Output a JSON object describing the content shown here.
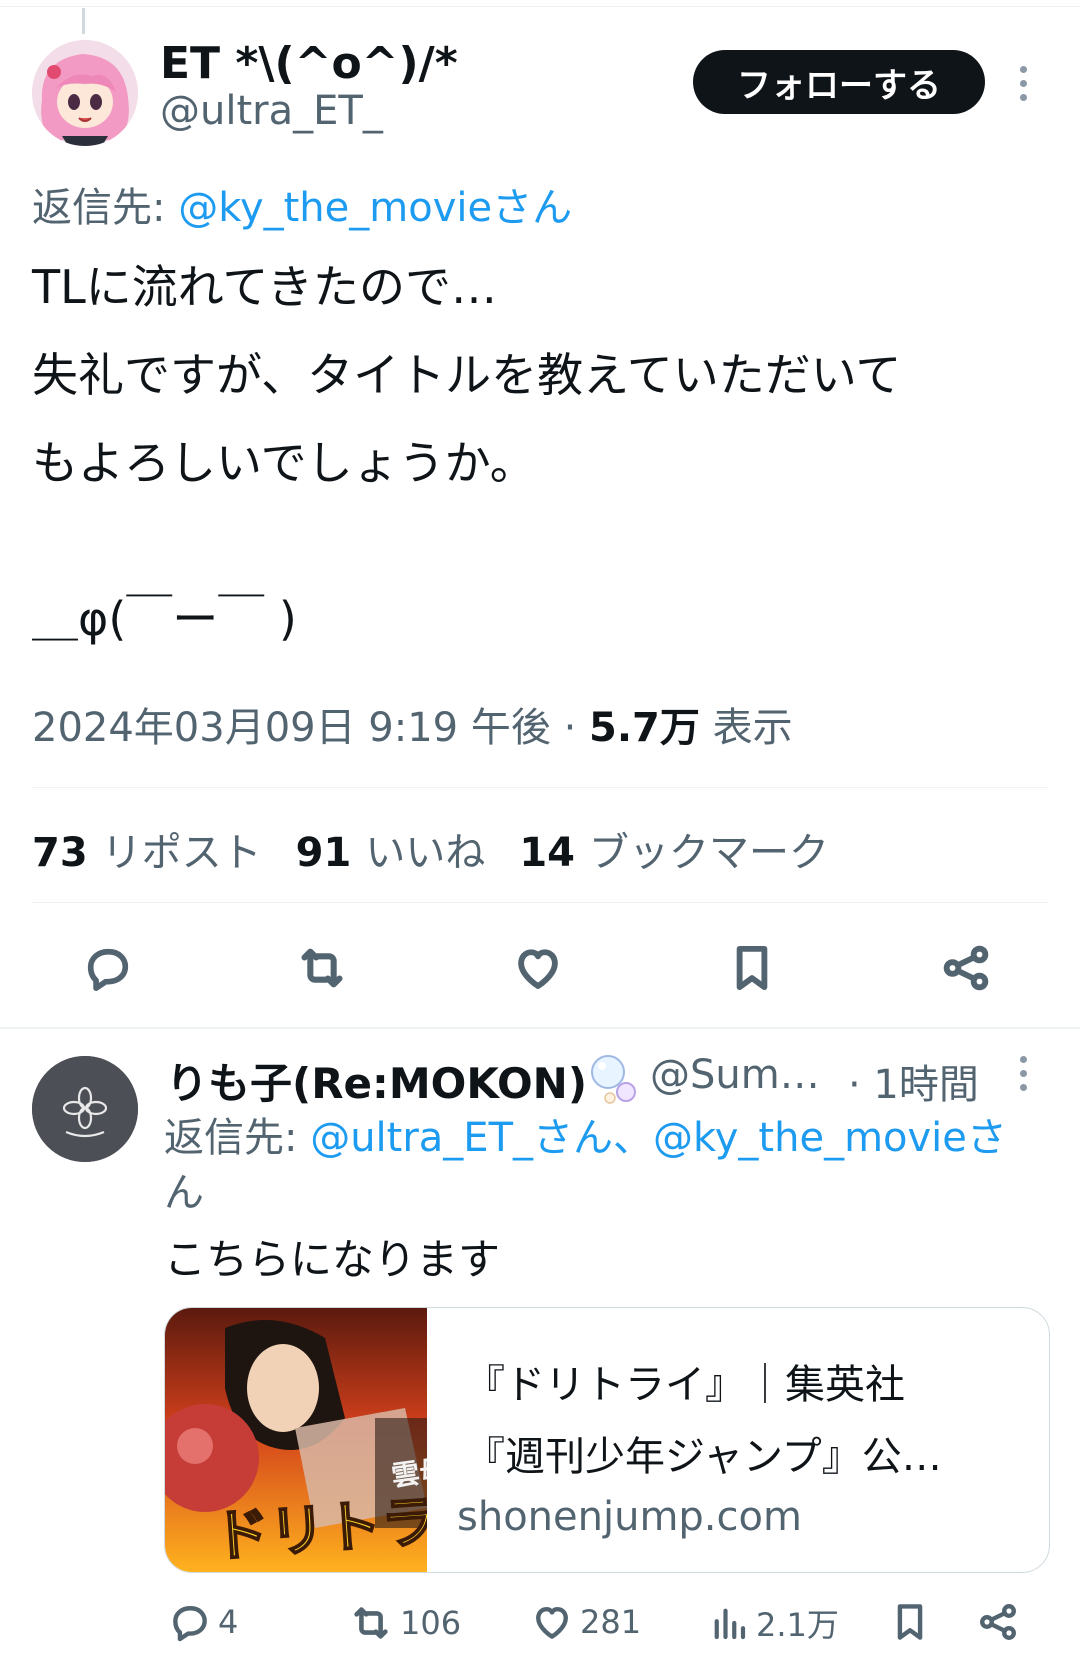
{
  "tweet": {
    "author_name": "ET  *\\(^o^)/*",
    "author_handle": "@ultra_ET_",
    "follow_label": "フォローする",
    "reply_to_prefix": "返信先: ",
    "reply_to_handle": "@ky_the_movieさん",
    "body_lines": [
      "TLに流れてきたので…",
      "失礼ですが、タイトルを教えていただいて",
      "もよろしいでしょうか。",
      "",
      "＿φ(￣ー￣ )"
    ],
    "timestamp": "2024年03月09日 9:19 午後",
    "separator": " · ",
    "views_count": "5.7万",
    "views_label": " 表示",
    "stats": [
      {
        "count": "73",
        "label": "リポスト"
      },
      {
        "count": "91",
        "label": "いいね"
      },
      {
        "count": "14",
        "label": "ブックマーク"
      }
    ],
    "actions": [
      "reply-icon",
      "retweet-icon",
      "like-icon",
      "bookmark-icon",
      "share-icon"
    ]
  },
  "reply": {
    "author_name": "りも子(Re:MOKON)",
    "author_handle": "@Sum…",
    "time": "· 1時間",
    "reply_to_prefix": "返信先: ",
    "reply_to_handles_line1": "@ultra_ET_さん、@ky_the_movieさ",
    "reply_to_handles_line2": "ん",
    "body": "こちらになります",
    "card": {
      "title_line1": "『ドリトライ』｜集英社",
      "title_line2": "『週刊少年ジャンプ』公…",
      "domain": "shonenjump.com",
      "image_text": "ドリトライ",
      "image_text2": "雲母坂盾"
    },
    "actions": {
      "reply_count": "4",
      "retweet_count": "106",
      "like_count": "281",
      "views_count": "2.1万"
    }
  },
  "colors": {
    "accent": "#1d9bf0",
    "text_primary": "#0f1419",
    "text_secondary": "#536471",
    "divider": "#eff3f4"
  }
}
